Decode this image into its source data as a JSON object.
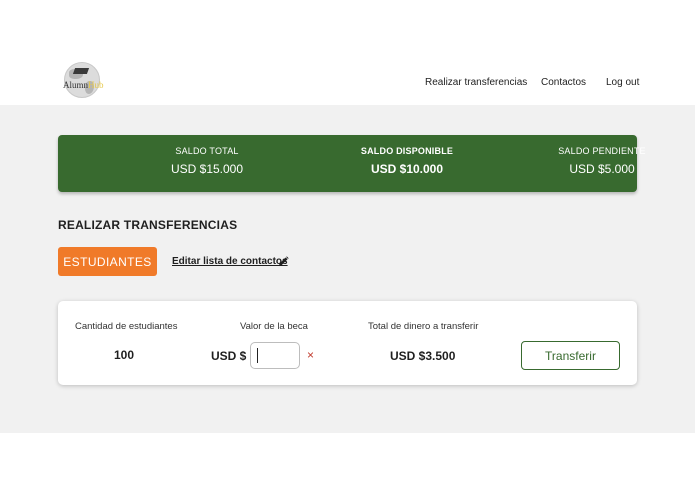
{
  "brand": {
    "name_main": "Alumn",
    "name_accent": "Hub"
  },
  "nav": {
    "items": [
      "Realizar transferencias",
      "Contactos",
      "Log out"
    ]
  },
  "balances": [
    {
      "label": "SALDO TOTAL",
      "value": "USD $15.000",
      "emphasis": false
    },
    {
      "label": "SALDO DISPONIBLE",
      "value": "USD $10.000",
      "emphasis": true
    },
    {
      "label": "SALDO PENDIENTE",
      "value": "USD $5.000",
      "emphasis": false
    }
  ],
  "section": {
    "title": "REALIZAR TRANSFERENCIAS",
    "tab_label": "ESTUDIANTES",
    "edit_link": "Editar lista de contactos"
  },
  "transfer": {
    "qty_label": "Cantidad de estudiantes",
    "qty_value": "100",
    "amount_label": "Valor de la beca",
    "currency_prefix": "USD $",
    "amount_value": "",
    "clear_symbol": "×",
    "total_label": "Total de dinero a transferir",
    "total_value": "USD $3.500",
    "submit_label": "Transferir"
  },
  "colors": {
    "primary_green": "#386a2f",
    "accent_orange": "#f07a29",
    "clear_red": "#c0392b",
    "page_bg": "#f1f1f1"
  },
  "icons": {
    "logo": "globe-graduation-cap-icon",
    "edit": "pencil-icon",
    "clear": "close-icon"
  }
}
